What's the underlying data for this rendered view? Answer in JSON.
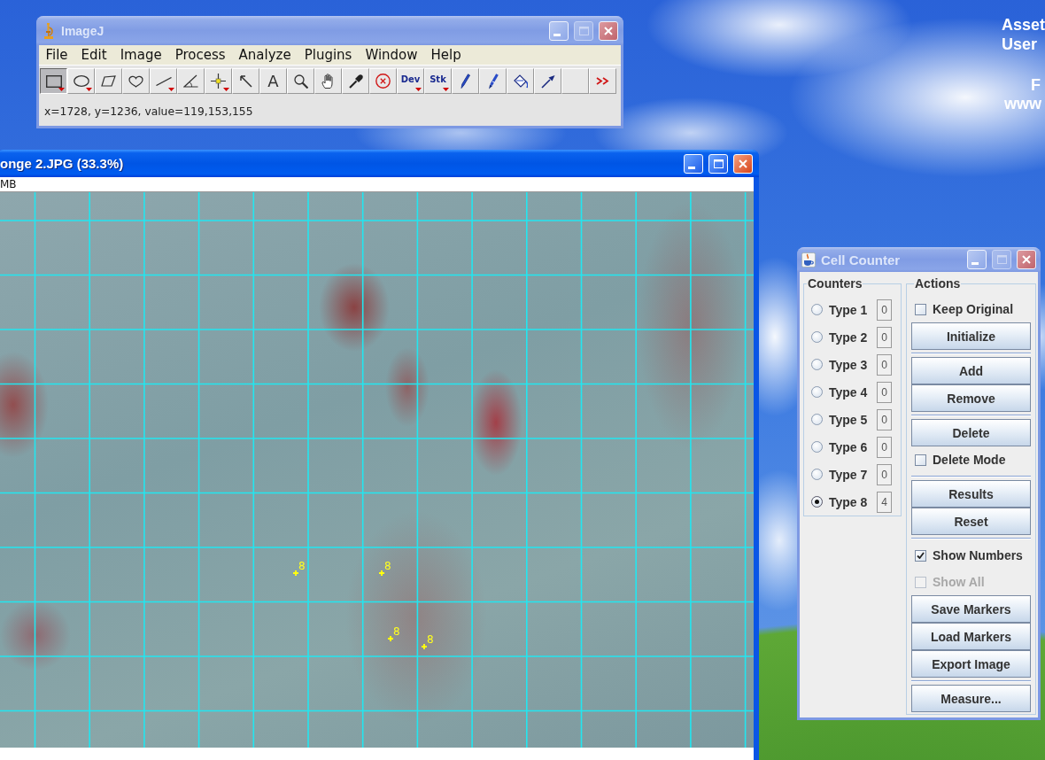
{
  "desktop_texts": [
    "Asset",
    "User",
    "F",
    "www"
  ],
  "imagej_window": {
    "title": "ImageJ",
    "active": false,
    "maximize_enabled": false,
    "menu": [
      "File",
      "Edit",
      "Image",
      "Process",
      "Analyze",
      "Plugins",
      "Window",
      "Help"
    ],
    "tools": [
      {
        "kind": "rectangle",
        "selected": true,
        "has_menu": true
      },
      {
        "kind": "oval",
        "selected": false,
        "has_menu": true
      },
      {
        "kind": "polygon",
        "selected": false,
        "has_menu": false
      },
      {
        "kind": "freehand",
        "selected": false,
        "has_menu": false
      },
      {
        "kind": "line",
        "selected": false,
        "has_menu": true
      },
      {
        "kind": "angle",
        "selected": false,
        "has_menu": false
      },
      {
        "kind": "point",
        "selected": false,
        "has_menu": true
      },
      {
        "kind": "wand",
        "selected": false,
        "has_menu": false
      },
      {
        "kind": "letter",
        "label": "A",
        "selected": false,
        "has_menu": false
      },
      {
        "kind": "magnifier",
        "selected": false,
        "has_menu": false
      },
      {
        "kind": "hand",
        "selected": false,
        "has_menu": false
      },
      {
        "kind": "dropper",
        "selected": false,
        "has_menu": false
      },
      {
        "kind": "circle-x",
        "selected": false,
        "has_menu": false
      },
      {
        "kind": "menu-label",
        "label": "Dev",
        "selected": false,
        "has_menu": true
      },
      {
        "kind": "menu-label",
        "label": "Stk",
        "selected": false,
        "has_menu": true
      },
      {
        "kind": "pencil",
        "selected": false,
        "has_menu": false
      },
      {
        "kind": "brush",
        "selected": false,
        "has_menu": false
      },
      {
        "kind": "bucket",
        "selected": false,
        "has_menu": false
      },
      {
        "kind": "pipette",
        "selected": false,
        "has_menu": false
      },
      {
        "kind": "empty",
        "selected": false,
        "has_menu": false
      },
      {
        "kind": "more",
        "selected": false,
        "has_menu": false
      }
    ],
    "status": "x=1728, y=1236, value=119,153,155"
  },
  "image_window": {
    "title": "onge 2.JPG (33.3%)",
    "active": true,
    "maximize_enabled": true,
    "info": "MB",
    "markers": [
      {
        "label": "8"
      },
      {
        "label": "8"
      },
      {
        "label": "8"
      },
      {
        "label": "8"
      }
    ]
  },
  "cell_counter": {
    "title": "Cell Counter",
    "active": false,
    "maximize_enabled": false,
    "counters_title": "Counters",
    "counters": [
      {
        "label": "Type 1",
        "count": "0",
        "selected": false
      },
      {
        "label": "Type 2",
        "count": "0",
        "selected": false
      },
      {
        "label": "Type 3",
        "count": "0",
        "selected": false
      },
      {
        "label": "Type 4",
        "count": "0",
        "selected": false
      },
      {
        "label": "Type 5",
        "count": "0",
        "selected": false
      },
      {
        "label": "Type 6",
        "count": "0",
        "selected": false
      },
      {
        "label": "Type 7",
        "count": "0",
        "selected": false
      },
      {
        "label": "Type 8",
        "count": "4",
        "selected": true
      }
    ],
    "actions_title": "Actions",
    "action_groups": [
      {
        "items": [
          {
            "kind": "checkbox",
            "label": "Keep Original",
            "checked": false,
            "disabled": false
          },
          {
            "kind": "button",
            "label": "Initialize"
          }
        ]
      },
      {
        "items": [
          {
            "kind": "button",
            "label": "Add"
          },
          {
            "kind": "button",
            "label": "Remove"
          }
        ]
      },
      {
        "items": [
          {
            "kind": "button",
            "label": "Delete"
          },
          {
            "kind": "checkbox",
            "label": "Delete Mode",
            "checked": false,
            "disabled": false
          }
        ]
      },
      {
        "items": [
          {
            "kind": "button",
            "label": "Results"
          },
          {
            "kind": "button",
            "label": "Reset"
          }
        ]
      },
      {
        "items": [
          {
            "kind": "checkbox",
            "label": "Show Numbers",
            "checked": true,
            "disabled": false
          },
          {
            "kind": "checkbox",
            "label": "Show All",
            "checked": false,
            "disabled": true
          },
          {
            "kind": "button",
            "label": "Save Markers"
          },
          {
            "kind": "button",
            "label": "Load Markers"
          },
          {
            "kind": "button",
            "label": "Export Image"
          }
        ]
      },
      {
        "items": [
          {
            "kind": "button",
            "label": "Measure..."
          }
        ]
      }
    ]
  }
}
